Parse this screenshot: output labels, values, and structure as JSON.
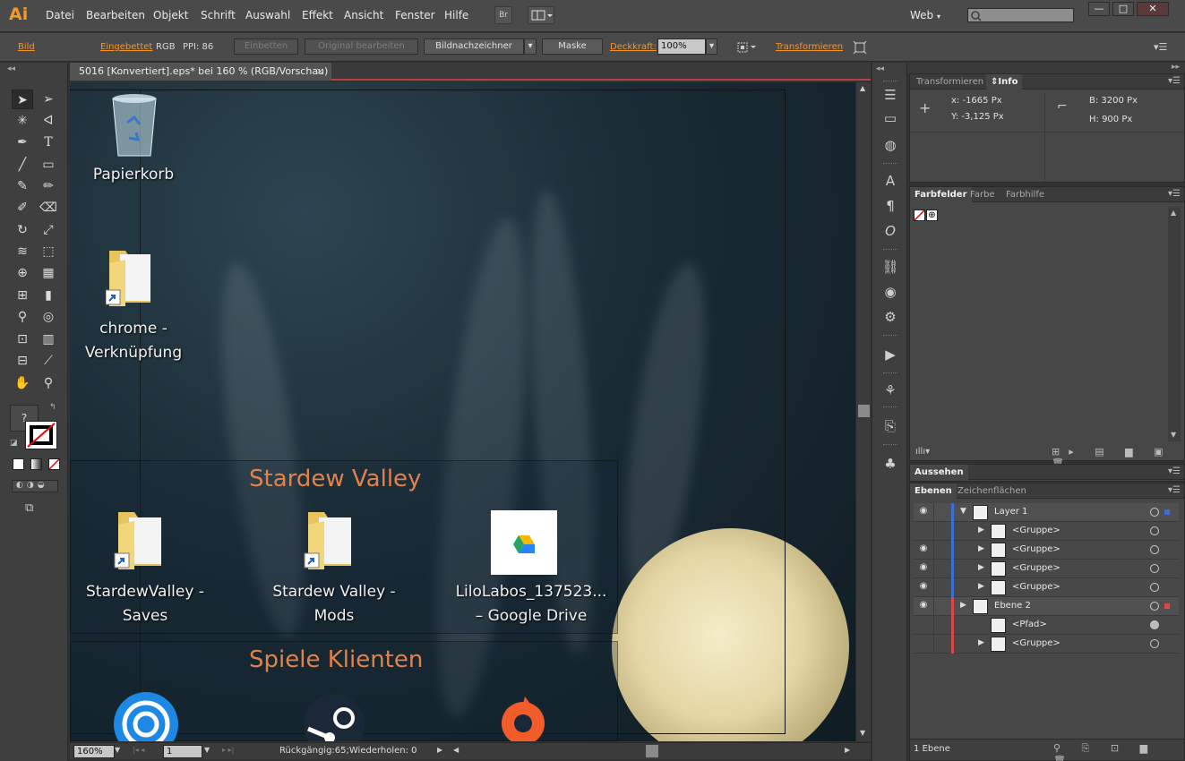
{
  "app": {
    "logo": "Ai",
    "menus": [
      "Datei",
      "Bearbeiten",
      "Objekt",
      "Schrift",
      "Auswahl",
      "Effekt",
      "Ansicht",
      "Fenster",
      "Hilfe"
    ],
    "bridge_label": "Br",
    "workspace": "Web",
    "window_controls": [
      "—",
      "□",
      "✕"
    ]
  },
  "controlbar": {
    "object_type": "Bild",
    "link_status": "Eingebettet",
    "color_mode": "RGB",
    "ppi": "PPI: 86",
    "embed_btn": "Einbetten",
    "edit_original_btn": "Original bearbeiten",
    "trace_btn": "Bildnachzeichner",
    "mask_btn": "Maske",
    "opacity_label": "Deckkraft:",
    "opacity_value": "100%",
    "transform_label": "Transformieren"
  },
  "document": {
    "tab_title": "5016 [Konvertiert].eps* bei 160 % (RGB/Vorschau)",
    "close": "×",
    "desktop": {
      "icons": [
        {
          "label1": "Papierkorb",
          "label2": ""
        },
        {
          "label1": "chrome -",
          "label2": "Verknüpfung"
        },
        {
          "label1": "StardewValley -",
          "label2": "Saves"
        },
        {
          "label1": "Stardew Valley -",
          "label2": "Mods"
        },
        {
          "label1": "LiloLabos_137523...",
          "label2": "– Google Drive"
        }
      ],
      "group_titles": [
        "Stardew Valley",
        "Spiele Klienten"
      ]
    }
  },
  "status": {
    "zoom": "160%",
    "artboard": "1",
    "history": "Rückgängig:65;Wiederholen: 0"
  },
  "panels": {
    "info": {
      "tabs": [
        "Transformieren",
        "Info"
      ],
      "x": "x:   -1665 Px",
      "y": "Y:   -3,125 Px",
      "w": "B:   3200 Px",
      "h": "H:   900 Px"
    },
    "swatches": {
      "tabs": [
        "Farbfelder",
        "Farbe",
        "Farbhilfe"
      ]
    },
    "appearance": {
      "tabs": [
        "Aussehen"
      ]
    },
    "layers": {
      "tabs": [
        "Ebenen",
        "Zeichenflächen"
      ],
      "rows": [
        {
          "name": "Layer 1",
          "eye": "true",
          "color": "#3b6fd4",
          "expanded": "▼",
          "indent": 0,
          "top": "true",
          "filled": "false",
          "sel": "#3b6fd4"
        },
        {
          "name": "<Gruppe>",
          "eye": "false",
          "color": "#3b6fd4",
          "expanded": "▶",
          "indent": 1,
          "top": "false",
          "filled": "false",
          "sel": ""
        },
        {
          "name": "<Gruppe>",
          "eye": "true",
          "color": "#3b6fd4",
          "expanded": "▶",
          "indent": 1,
          "top": "false",
          "filled": "false",
          "sel": ""
        },
        {
          "name": "<Gruppe>",
          "eye": "true",
          "color": "#3b6fd4",
          "expanded": "▶",
          "indent": 1,
          "top": "false",
          "filled": "false",
          "sel": ""
        },
        {
          "name": "<Gruppe>",
          "eye": "true",
          "color": "#3b6fd4",
          "expanded": "▶",
          "indent": 1,
          "top": "false",
          "filled": "false",
          "sel": ""
        },
        {
          "name": "Ebene 2",
          "eye": "true",
          "color": "#d94848",
          "expanded": "▶",
          "indent": 0,
          "top": "true",
          "filled": "false",
          "sel": "#e04848"
        },
        {
          "name": "<Pfad>",
          "eye": "false",
          "color": "#d94848",
          "expanded": "",
          "indent": 1,
          "top": "false",
          "filled": "true",
          "sel": ""
        },
        {
          "name": "<Gruppe>",
          "eye": "false",
          "color": "#d94848",
          "expanded": "▶",
          "indent": 1,
          "top": "false",
          "filled": "false",
          "sel": ""
        }
      ],
      "footer": "1 Ebene"
    }
  }
}
